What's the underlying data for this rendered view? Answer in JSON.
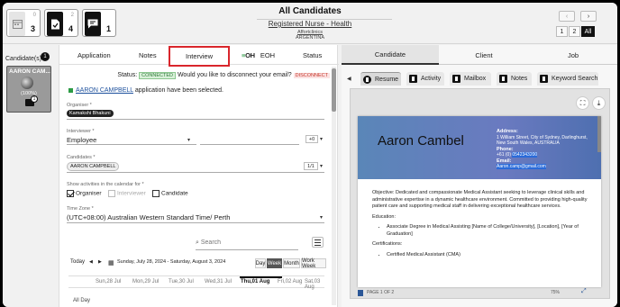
{
  "header": {
    "title": "All Candidates",
    "job_title": "Registered Nurse - Health",
    "client": "Affortclinics",
    "country": "ARGENTINA",
    "tiles": [
      {
        "top_count": "0",
        "count": "3"
      },
      {
        "top_count": "2",
        "count": "4"
      },
      {
        "top_count": "",
        "count": "1"
      }
    ],
    "nav_prev": "‹",
    "nav_next": "›",
    "pages": [
      "1",
      "2",
      "All"
    ]
  },
  "rail": {
    "label": "Candidate(s)",
    "badge": "1",
    "candidate": {
      "name": "AARON CAM...",
      "percent": "(100%)",
      "badge": "1"
    }
  },
  "middle": {
    "tabs": [
      "Application",
      "Notes",
      "Interview",
      "EOH",
      "Status"
    ],
    "eoh_logo": {
      "prefix": "≡",
      "text": "OH"
    },
    "status": {
      "label": "Status:",
      "state": "CONNECTED",
      "question": "Would you like to disconnect your email?",
      "action": "DISCONNECT"
    },
    "selected": {
      "name": "AARON CAMPBELL",
      "text": "application have been selected."
    },
    "organiser": {
      "label": "Organiser *",
      "value": "Kamakshi Bhakuni"
    },
    "interviewer": {
      "label": "Interviewer *",
      "value": "Employee",
      "stepper": "+0"
    },
    "candidates": {
      "label": "Candidates *",
      "value": "AARON CAMPBELL",
      "count": "1/1"
    },
    "show_activities": {
      "label": "Show activities in the calendar for *",
      "options": [
        {
          "label": "Organiser",
          "checked": true,
          "disabled": false
        },
        {
          "label": "Interviewer",
          "checked": false,
          "disabled": true
        },
        {
          "label": "Candidate",
          "checked": false,
          "disabled": false
        }
      ]
    },
    "timezone": {
      "label": "Time Zone *",
      "value": "(UTC+08:00) Australian Western Standard Time/ Perth"
    },
    "search_placeholder": "Search",
    "calendar": {
      "today": "Today",
      "range": "Sunday, July 28, 2024 - Saturday, August 3, 2024",
      "views": [
        "Day",
        "Week",
        "Month",
        "Work Week"
      ],
      "active_view": "Week",
      "days": [
        "Sun,28 Jul",
        "Mon,29 Jul",
        "Tue,30 Jul",
        "Wed,31 Jul",
        "Thu,01 Aug",
        "Fri,02 Aug",
        "Sat,03 Aug"
      ],
      "all_day": "All Day"
    }
  },
  "right": {
    "tabs": [
      "Candidate",
      "Client",
      "Job"
    ],
    "subtabs": [
      "Resume",
      "Activity",
      "Mailbox",
      "Notes",
      "Keyword Search"
    ],
    "resume": {
      "name": "Aaron Cambel",
      "address_label": "Address:",
      "address": "1 William Street, City of Sydney, Darlinghurst, New South Wales, AUSTRALIA",
      "phone_label": "Phone:",
      "phone_prefix": "+61 (0)",
      "phone": "0542343200",
      "email_label": "Email:",
      "email": "Aaron.camp@gmail.com",
      "objective": "Objective: Dedicated and compassionate Medical Assistant seeking to leverage clinical skills and administrative expertise in a dynamic healthcare environment. Committed to providing high-quality patient care and supporting medical staff in delivering exceptional healthcare services.",
      "education_label": "Education:",
      "education_item": "Associate Degree in Medical Assisting [Name of College/University], [Location], [Year of Graduation]",
      "certifications_label": "Certifications:",
      "certification_item": "Certified Medical Assistant (CMA)",
      "footer_page": "PAGE 1 OF 2",
      "footer_zoom": "75%"
    }
  }
}
